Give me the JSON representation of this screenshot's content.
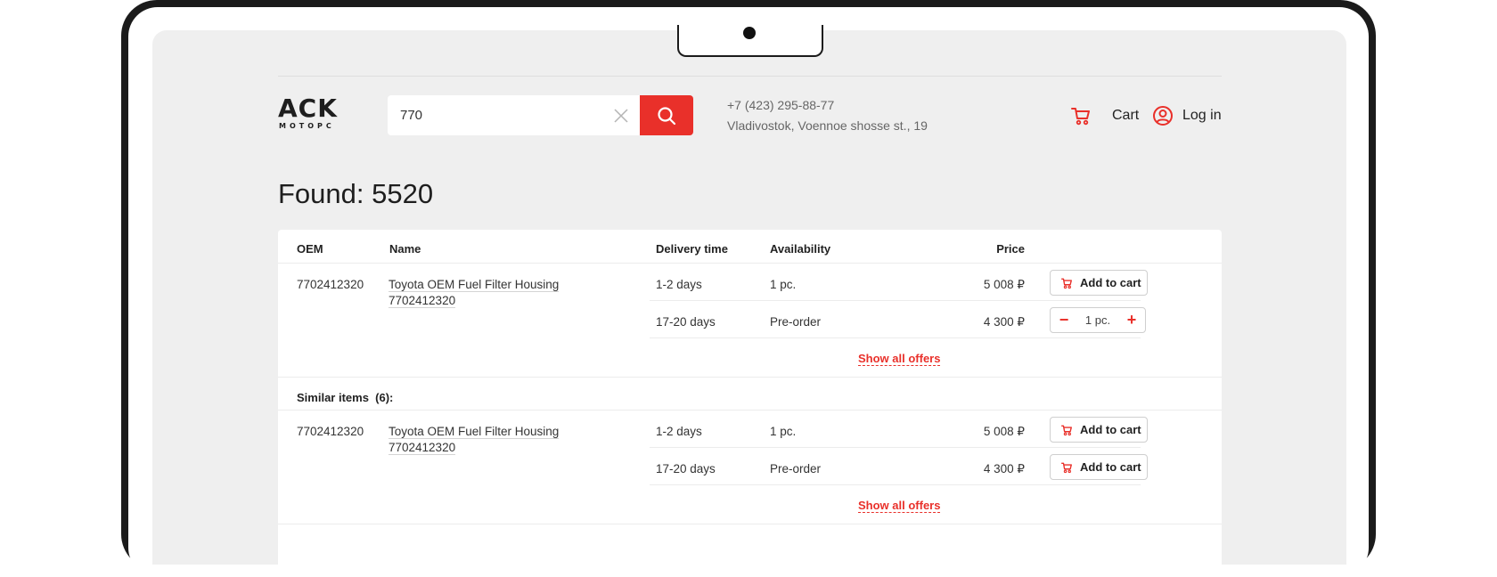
{
  "header": {
    "logo_main": "ACK",
    "logo_sub": "МОТОРС",
    "search_value": "770",
    "phone": "+7 (423) 295-88-77",
    "address": "Vladivostok, Voennoe shosse st., 19",
    "cart_label": "Cart",
    "login_label": "Log in"
  },
  "page": {
    "title": "Found: 5520"
  },
  "table": {
    "columns": {
      "oem": "OEM",
      "name": "Name",
      "delivery": "Delivery time",
      "availability": "Availability",
      "price": "Price"
    },
    "groups": [
      {
        "oem": "7702412320",
        "name_line1": "Toyota OEM Fuel Filter Housing",
        "name_line2": "7702412320",
        "offers": [
          {
            "delivery": "1-2 days",
            "availability": "1 pc.",
            "price": "5 008 ₽",
            "action": "Add to cart"
          },
          {
            "delivery": "17-20 days",
            "availability": "Pre-order",
            "price": "4 300 ₽",
            "qty": "1 pc."
          }
        ],
        "show_all": "Show all offers"
      },
      {
        "oem": "7702412320",
        "name_line1": "Toyota OEM Fuel Filter Housing",
        "name_line2": "7702412320",
        "offers": [
          {
            "delivery": "1-2 days",
            "availability": "1 pc.",
            "price": "5 008 ₽",
            "action": "Add to cart"
          },
          {
            "delivery": "17-20 days",
            "availability": "Pre-order",
            "price": "4 300 ₽",
            "action": "Add to cart"
          }
        ],
        "show_all": "Show all offers"
      }
    ],
    "similar_label": "Similar items  (6):"
  },
  "icons": {
    "clear": "close-icon",
    "search": "search-icon",
    "cart": "cart-icon",
    "user": "user-icon"
  },
  "colors": {
    "accent": "#e9302a",
    "page_bg": "#efefef",
    "card_bg": "#ffffff"
  }
}
